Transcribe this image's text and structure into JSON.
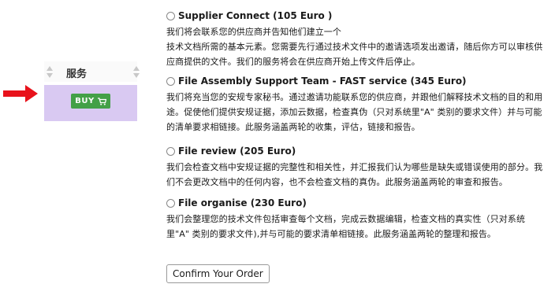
{
  "table": {
    "column_title": "服务",
    "buy_label": "BUY"
  },
  "options": [
    {
      "title": "Supplier Connect (105 Euro )",
      "lines": [
        "我们将会联系您的供应商并告知他们建立一个",
        "技术文档所需的基本元素。您需要先行通过技术文件中的邀请选项发出邀请，随后你方可以审核供",
        "应商提供的文件。我们的服务将会在供应商开始上传文件后停止。"
      ]
    },
    {
      "title": "File Assembly Support Team - FAST service (345 Euro)",
      "lines": [
        "我们将充当您的安规专家秘书。通过邀请功能联系您的供应商，并跟他们解释技术文档的目的和用",
        "途。促使他们提供安规证据，添加云数据，检查真伪（只对系统里\"A\" 类别的要求文件）并与可能",
        "的清单要求相链接。此服务涵盖两轮的收集，评估，链接和报告。"
      ]
    },
    {
      "title": "File review (205 Euro)",
      "lines": [
        "我们会检查文档中安规证据的完整性和相关性，并汇报我们认为哪些是缺失或错误使用的部分。我",
        "们不会更改文档中的任何内容，也不会检查文档的真伪。此服务涵盖两轮的审查和报告。"
      ]
    },
    {
      "title": "File organise (230 Euro)",
      "lines": [
        "我们会整理您的技术文件包括审查每个文档，完成云数据编辑，检查文档的真实性（只对系统",
        "里\"A\" 类别的要求文件),并与可能的要求清单相链接。此服务涵盖两轮的整理和报告。"
      ]
    }
  ],
  "confirm_label": "Confirm Your Order",
  "colors": {
    "arrow": "#e8121b",
    "buy_button": "#43a047",
    "cell_background": "#d9c9f2"
  },
  "icons": [
    "arrow-right-icon",
    "sort-icon",
    "cart-icon",
    "radio-icon"
  ]
}
